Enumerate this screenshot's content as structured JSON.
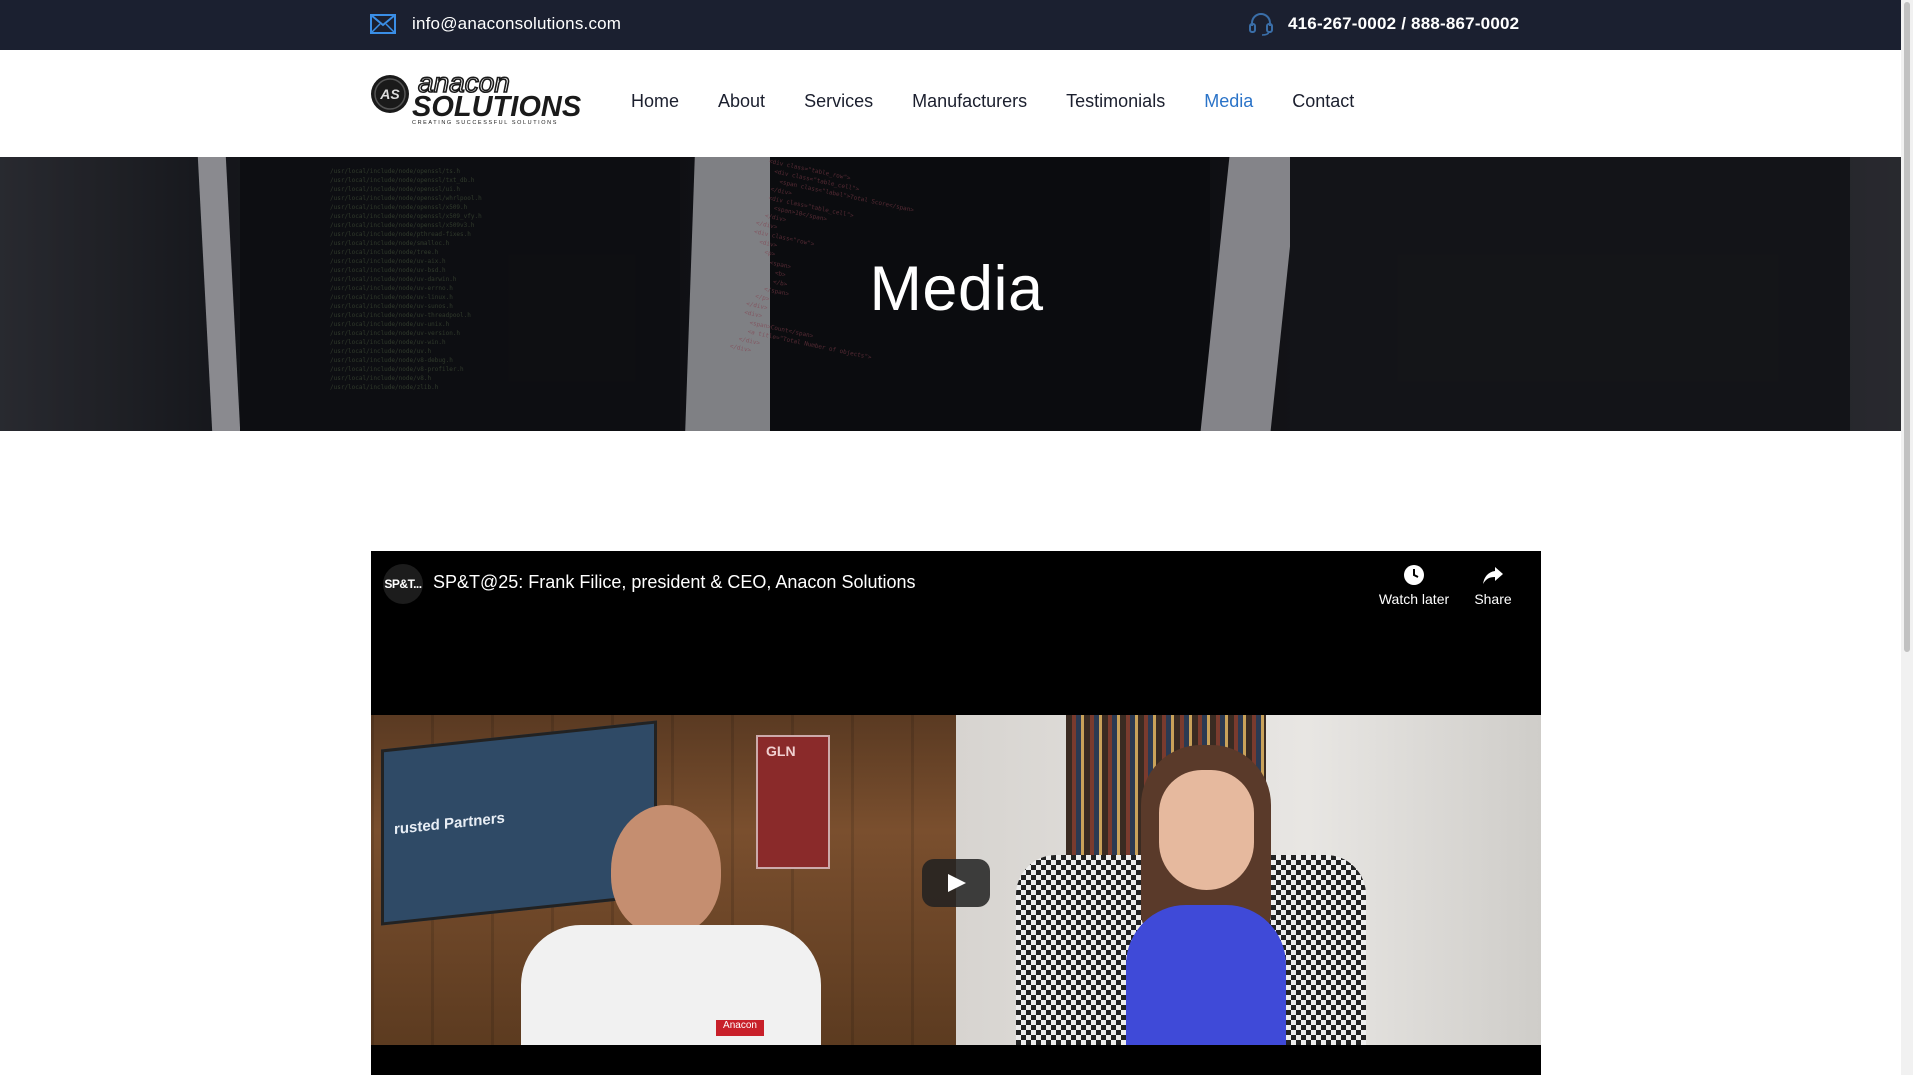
{
  "topbar": {
    "email": "info@anaconsolutions.com",
    "phone": "416-267-0002 / 888-867-0002",
    "email_icon": "envelope-icon",
    "phone_icon": "headset-icon"
  },
  "logo": {
    "line1": "anacon",
    "line2": "SOLUTIONS",
    "tagline": "CREATING SUCCESSFUL SOLUTIONS",
    "badge": "AS"
  },
  "nav": {
    "items": [
      {
        "label": "Home",
        "active": false
      },
      {
        "label": "About",
        "active": false
      },
      {
        "label": "Services",
        "active": false
      },
      {
        "label": "Manufacturers",
        "active": false
      },
      {
        "label": "Testimonials",
        "active": false
      },
      {
        "label": "Media",
        "active": true
      },
      {
        "label": "Contact",
        "active": false
      }
    ],
    "active_color": "#2a73c8",
    "text_color": "#1b1f2e"
  },
  "hero": {
    "title": "Media"
  },
  "video": {
    "channel_abbr": "SP&T...",
    "title": "SP&T@25: Frank Filice, president & CEO, Anacon Solutions",
    "watch_later_label": "Watch later",
    "share_label": "Share",
    "left_screen_text": "rusted Partners",
    "shirt_text": "Anacon",
    "poster_text": "GLN"
  },
  "colors": {
    "topbar_bg": "#1b2030",
    "active_link": "#2a73c8",
    "video_bg": "#000000"
  }
}
